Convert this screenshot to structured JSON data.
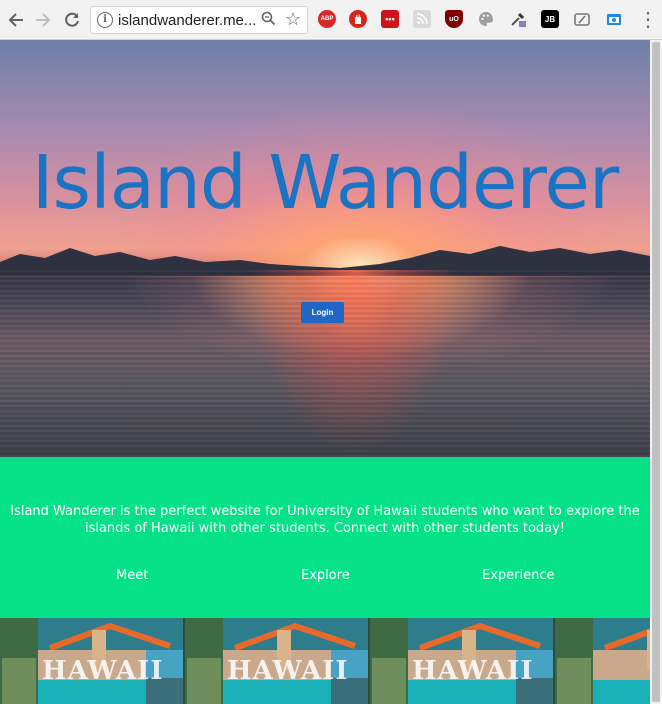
{
  "browser": {
    "url": "islandwanderer.me...",
    "icons": {
      "back": "back-arrow-icon",
      "forward": "forward-arrow-icon",
      "reload": "reload-icon",
      "info": "info-icon",
      "zoom": "zoom-icon",
      "star": "bookmark-star-icon",
      "menu": "menu-dots-icon"
    },
    "extensions": {
      "abp_label": "ABP",
      "jb_label": "JB",
      "ub_label": "uO",
      "lastpass_label": "•••"
    }
  },
  "hero": {
    "title": "Island Wanderer",
    "login_label": "Login",
    "title_color": "#1a73c3",
    "login_color": "#2166c4"
  },
  "about": {
    "description": "Island Wanderer is the perfect website for University of Hawaii students who want to explore the islands of Hawaii with other students. Connect with other students today!",
    "features": [
      "Meet",
      "Explore",
      "Experience"
    ],
    "band_color": "#05e187"
  },
  "strip": {
    "banner_text": "HAWAII"
  }
}
